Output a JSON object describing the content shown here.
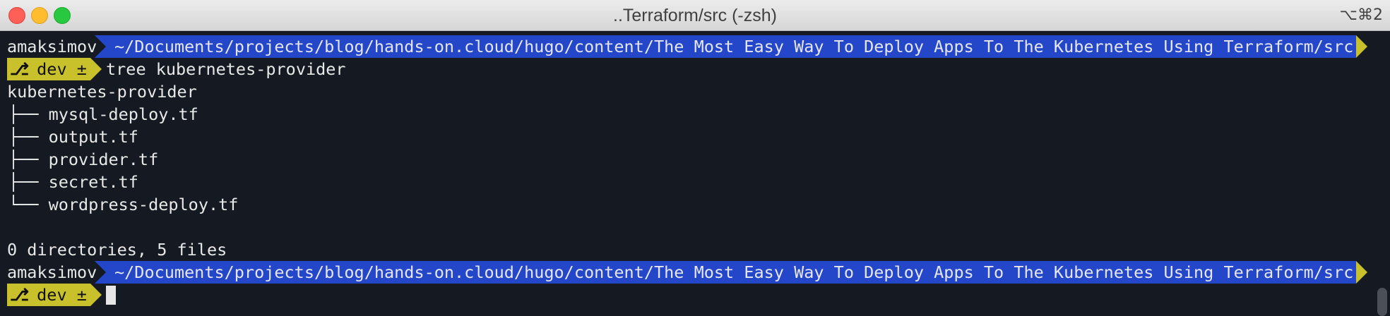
{
  "window": {
    "title": "..Terraform/src (-zsh)",
    "shortcut": "⌥⌘2"
  },
  "prompt": {
    "user": "amaksimov",
    "path": "~/Documents/projects/blog/hands-on.cloud/hugo/content/The Most Easy Way To Deploy Apps To The Kubernetes Using Terraform/src",
    "branch_icon": "git-branch-icon",
    "branch_label": "dev ±"
  },
  "command": "tree kubernetes-provider",
  "output": {
    "root": "kubernetes-provider",
    "entries": [
      "├── mysql-deploy.tf",
      "├── output.tf",
      "├── provider.tf",
      "├── secret.tf",
      "└── wordpress-deploy.tf"
    ],
    "summary": "0 directories, 5 files"
  },
  "colors": {
    "path_bg": "#2347c8",
    "git_bg": "#c9c12b",
    "terminal_bg": "#151a22"
  }
}
